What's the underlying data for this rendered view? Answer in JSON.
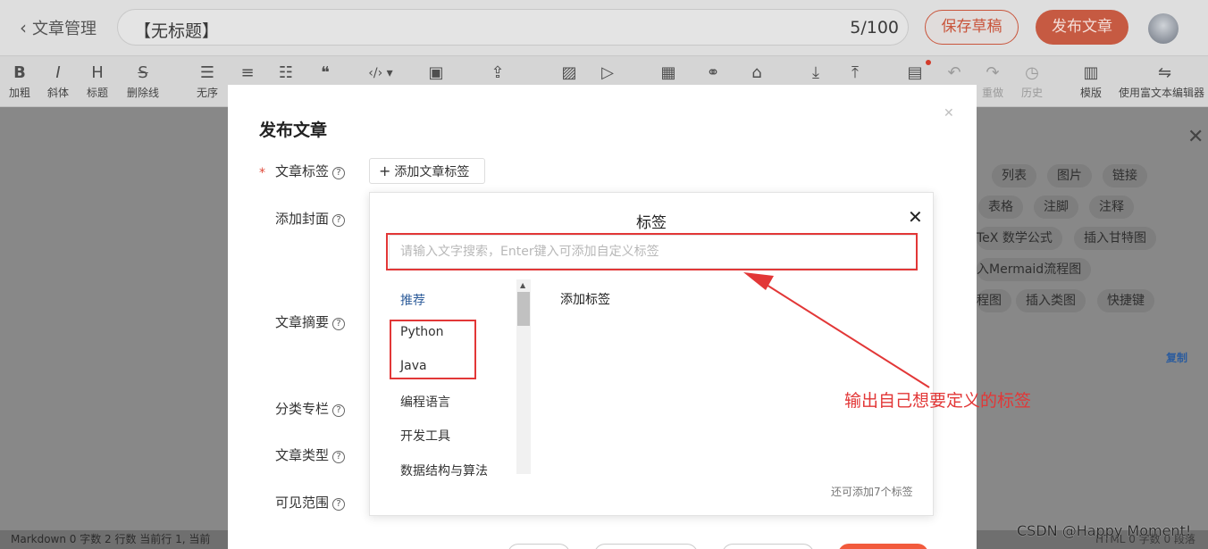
{
  "header": {
    "back_label": "文章管理",
    "title_value": "【无标题】",
    "title_count": "5/100",
    "save_draft": "保存草稿",
    "publish": "发布文章"
  },
  "toolbar": {
    "items": [
      {
        "icon": "B",
        "label": "加粗"
      },
      {
        "icon": "I",
        "label": "斜体"
      },
      {
        "icon": "H",
        "label": "标题"
      },
      {
        "icon": "S",
        "label": "删除线"
      },
      {
        "icon": "☰",
        "label": "无序"
      },
      {
        "icon": "≡",
        "label": ""
      },
      {
        "icon": "☷",
        "label": ""
      },
      {
        "icon": "❝",
        "label": ""
      },
      {
        "icon": "‹/› ▾",
        "label": ""
      },
      {
        "icon": "▣",
        "label": ""
      },
      {
        "icon": "⇪",
        "label": ""
      },
      {
        "icon": "▨",
        "label": ""
      },
      {
        "icon": "▷",
        "label": ""
      },
      {
        "icon": "▦",
        "label": ""
      },
      {
        "icon": "⚭",
        "label": ""
      },
      {
        "icon": "⌂",
        "label": ""
      },
      {
        "icon": "⤓",
        "label": ""
      },
      {
        "icon": "⤒",
        "label": ""
      },
      {
        "icon": "▤",
        "label": ""
      },
      {
        "icon": "↶",
        "label": ""
      },
      {
        "icon": "↷",
        "label": "重做"
      },
      {
        "icon": "◷",
        "label": "历史"
      },
      {
        "icon": "▥",
        "label": "模版"
      },
      {
        "icon": "⇋",
        "label": "使用富文本编辑器"
      }
    ]
  },
  "help_chips": [
    "列表",
    "图片",
    "链接",
    "表格",
    "注脚",
    "注释",
    "TeX 数学公式",
    "插入甘特图",
    "入Mermaid流程图",
    "程图",
    "插入类图",
    "快捷键"
  ],
  "copy_label": "复制",
  "statusbar": {
    "left": "Markdown   0 字数   2 行数   当前行 1, 当前",
    "right": "HTML   0 字数   0 段落"
  },
  "watermark": "CSDN @Happy Moment!",
  "modal": {
    "title": "发布文章",
    "required_mark": "*",
    "fields": {
      "tags": "文章标签",
      "cover": "添加封面",
      "summary": "文章摘要",
      "column": "分类专栏",
      "type": "文章类型",
      "visibility": "可见范围"
    },
    "help_glyph": "?",
    "add_tag_button": "添加文章标签"
  },
  "tag_popup": {
    "title": "标签",
    "search_placeholder": "请输入文字搜索，Enter键入可添加自定义标签",
    "search_value": "",
    "categories": [
      "推荐",
      "Python",
      "Java",
      "编程语言",
      "开发工具",
      "数据结构与算法"
    ],
    "active_category": "推荐",
    "add_label": "添加标签",
    "remaining": "还可添加7个标签"
  },
  "annotation": {
    "text": "输出自己想要定义的标签",
    "color": "#e23737"
  },
  "colors": {
    "accent": "#f25a3c",
    "link": "#2f5d9a"
  }
}
